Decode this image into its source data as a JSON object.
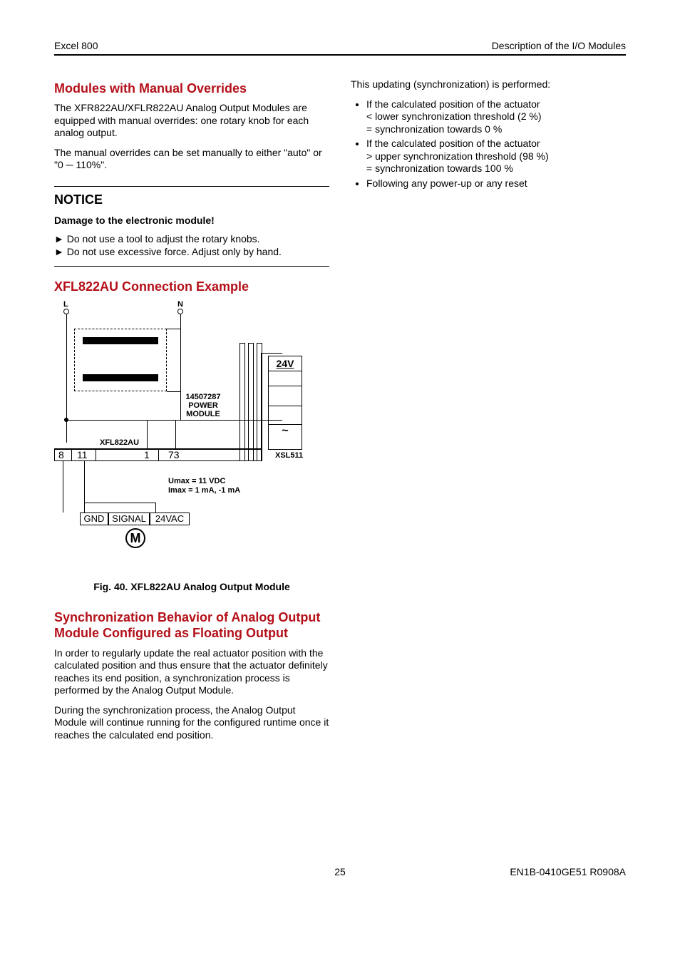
{
  "header": {
    "left": "Excel 800",
    "right": "Description of the I/O Modules"
  },
  "left": {
    "s1_title": "Modules with Manual Overrides",
    "s1_p1": "The XFR822AU/XFLR822AU Analog Output Modules are equipped with manual overrides: one rotary knob for each analog output.",
    "s1_p2": "The manual overrides can be set manually to either \"auto\" or \"0 ─ 110%\".",
    "notice_title": "NOTICE",
    "notice_sub": "Damage to the electronic module!",
    "notice_li1": "Do not use a tool to adjust the rotary knobs.",
    "notice_li2": "Do not use excessive force. Adjust only by hand.",
    "s2_title": "XFL822AU Connection Example",
    "fig_caption": "Fig. 40. XFL822AU Analog Output Module",
    "s3_title": "Synchronization Behavior of Analog Output Module Configured as Floating Output",
    "s3_p1": "In order to regularly update the real actuator position with the calculated position and thus ensure that the actuator definitely reaches its end position, a synchronization process is performed by the Analog Output Module.",
    "s3_p2": "During the synchronization process, the Analog Output Module will continue running for the configured runtime once it reaches the calculated end position."
  },
  "right": {
    "p0": "This updating (synchronization) is performed:",
    "b1a": "If the calculated position of the actuator",
    "b1b": "< lower synchronization threshold (2 %)",
    "b1c": "= synchronization towards 0 %",
    "b2a": "If the calculated position of the actuator",
    "b2b": "> upper synchronization threshold (98 %)",
    "b2c": "= synchronization towards 100 %",
    "b3": "Following any power-up or any reset"
  },
  "diagram": {
    "L": "L",
    "N": "N",
    "mod_label": "XFL822AU",
    "pm1": "14507287",
    "pm2": "POWER",
    "pm3": "MODULE",
    "t8": "8",
    "t11": "11",
    "t1": "1",
    "t73": "73",
    "xsl": "XSL511",
    "v24": "24V",
    "tilde": "~",
    "u1": "Umax = 11 VDC",
    "u2": "Imax = 1 mA, -1 mA",
    "gnd": "GND",
    "sig": "SIGNAL",
    "vac": "24VAC",
    "M": "M"
  },
  "footer": {
    "page": "25",
    "doc": "EN1B-0410GE51 R0908A"
  }
}
